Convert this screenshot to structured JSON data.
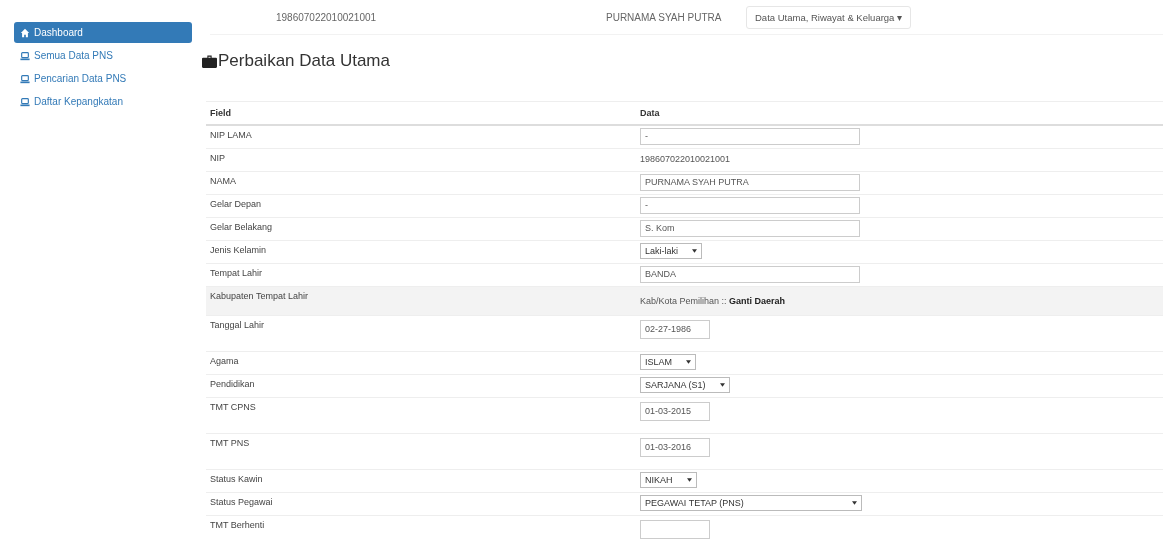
{
  "sidebar": {
    "items": [
      {
        "label": "Dashboard",
        "selected": true
      },
      {
        "label": "Semua Data PNS",
        "selected": false
      },
      {
        "label": "Pencarian Data PNS",
        "selected": false
      },
      {
        "label": "Daftar Kepangkatan",
        "selected": false
      }
    ]
  },
  "header": {
    "nip": "198607022010021001",
    "name": "PURNAMA SYAH PUTRA",
    "menu": "Data Utama, Riwayat & Keluarga ▾"
  },
  "page_title": "Perbaikan Data Utama",
  "table": {
    "columns": [
      "Field",
      "Data"
    ],
    "rows": [
      {
        "field": "NIP LAMA",
        "kind": "input",
        "value": "-"
      },
      {
        "field": "NIP",
        "kind": "text",
        "value": "198607022010021001"
      },
      {
        "field": "NAMA",
        "kind": "input",
        "value": "PURNAMA SYAH PUTRA"
      },
      {
        "field": "Gelar Depan",
        "kind": "input",
        "value": "-"
      },
      {
        "field": "Gelar Belakang",
        "kind": "input",
        "value": "S. Kom"
      },
      {
        "field": "Jenis Kelamin",
        "kind": "select",
        "value": "Laki-laki"
      },
      {
        "field": "Tempat Lahir",
        "kind": "input",
        "value": "BANDA"
      },
      {
        "field": "Kabupaten Tempat Lahir",
        "kind": "text",
        "shaded": true,
        "value": "Kab/Kota Pemilihan :: **Ganti Daerah**"
      },
      {
        "field": "Tanggal Lahir",
        "kind": "date",
        "value": "02-27-1986"
      },
      {
        "field": "Agama",
        "kind": "select",
        "value": "ISLAM"
      },
      {
        "field": "Pendidikan",
        "kind": "select",
        "value": "SARJANA (S1)"
      },
      {
        "field": "TMT CPNS",
        "kind": "date",
        "value": "01-03-2015"
      },
      {
        "field": "TMT PNS",
        "kind": "date",
        "value": "01-03-2016"
      },
      {
        "field": "Status Kawin",
        "kind": "select",
        "value": "NIKAH"
      },
      {
        "field": "Status Pegawai",
        "kind": "wideselect",
        "value": "PEGAWAI TETAP (PNS)"
      },
      {
        "field": "TMT Berhenti",
        "kind": "date"
      }
    ]
  }
}
